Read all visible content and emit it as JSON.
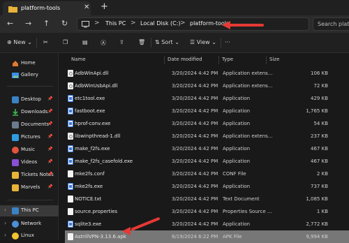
{
  "window": {
    "tab_title": "platform-tools",
    "close_glyph": "✕",
    "new_tab_glyph": "+"
  },
  "address": {
    "back_glyph": "←",
    "forward_glyph": "→",
    "up_glyph": "↑",
    "refresh_glyph": "↻",
    "chevron": ">",
    "crumbs": [
      "This PC",
      "Local Disk (C:)",
      "platform-tools"
    ],
    "search_placeholder": "Search platfo"
  },
  "toolbar": {
    "new_label": "New",
    "sort_label": "Sort",
    "view_label": "View",
    "more_label": "···"
  },
  "sidebar": {
    "top": [
      {
        "label": "Home",
        "icon": "home-icon"
      },
      {
        "label": "Gallery",
        "icon": "gallery-icon"
      }
    ],
    "pinned": [
      {
        "label": "Desktop",
        "icon": "desktop-icon"
      },
      {
        "label": "Downloads",
        "icon": "download-icon"
      },
      {
        "label": "Documents",
        "icon": "documents-icon"
      },
      {
        "label": "Pictures",
        "icon": "pictures-icon"
      },
      {
        "label": "Music",
        "icon": "music-icon"
      },
      {
        "label": "Videos",
        "icon": "videos-icon"
      },
      {
        "label": "Tickets Notes",
        "icon": "folder-icon"
      },
      {
        "label": "Marvels",
        "icon": "folder-icon"
      }
    ],
    "bottom": [
      {
        "label": "This PC",
        "icon": "pc-icon"
      },
      {
        "label": "Network",
        "icon": "network-icon"
      },
      {
        "label": "Linux",
        "icon": "linux-icon"
      }
    ],
    "pin_glyph": "📌",
    "chevron_glyph": "›"
  },
  "table": {
    "columns": [
      "Name",
      "Date modified",
      "Type",
      "Size"
    ],
    "rows": [
      {
        "name": "AdbWinApi.dll",
        "date": "3/20/2024 4:42 PM",
        "type": "Application extens...",
        "size": "106 KB",
        "kind": "dll"
      },
      {
        "name": "AdbWinUsbApi.dll",
        "date": "3/20/2024 4:42 PM",
        "type": "Application extens...",
        "size": "72 KB",
        "kind": "dll"
      },
      {
        "name": "etc1tool.exe",
        "date": "3/20/2024 4:42 PM",
        "type": "Application",
        "size": "429 KB",
        "kind": "exe"
      },
      {
        "name": "fastboot.exe",
        "date": "3/20/2024 4:42 PM",
        "type": "Application",
        "size": "1,765 KB",
        "kind": "exe"
      },
      {
        "name": "hprof-conv.exe",
        "date": "3/20/2024 4:42 PM",
        "type": "Application",
        "size": "54 KB",
        "kind": "exe"
      },
      {
        "name": "libwinpthread-1.dll",
        "date": "3/20/2024 4:42 PM",
        "type": "Application extens...",
        "size": "237 KB",
        "kind": "dll"
      },
      {
        "name": "make_f2fs.exe",
        "date": "3/20/2024 4:42 PM",
        "type": "Application",
        "size": "467 KB",
        "kind": "exe"
      },
      {
        "name": "make_f2fs_casefold.exe",
        "date": "3/20/2024 4:42 PM",
        "type": "Application",
        "size": "467 KB",
        "kind": "exe"
      },
      {
        "name": "mke2fs.conf",
        "date": "3/20/2024 4:42 PM",
        "type": "CONF File",
        "size": "2 KB",
        "kind": "file"
      },
      {
        "name": "mke2fs.exe",
        "date": "3/20/2024 4:42 PM",
        "type": "Application",
        "size": "737 KB",
        "kind": "exe"
      },
      {
        "name": "NOTICE.txt",
        "date": "3/20/2024 4:42 PM",
        "type": "Text Document",
        "size": "1,085 KB",
        "kind": "file"
      },
      {
        "name": "source.properties",
        "date": "3/20/2024 4:42 PM",
        "type": "Properties Source ...",
        "size": "1 KB",
        "kind": "file"
      },
      {
        "name": "sqlite3.exe",
        "date": "3/20/2024 4:42 PM",
        "type": "Application",
        "size": "2,772 KB",
        "kind": "exe"
      },
      {
        "name": "AstrillVPN-3.13.6.apk",
        "date": "6/19/2024 6:22 PM",
        "type": "APK File",
        "size": "9,994 KB",
        "kind": "file",
        "selected": true
      }
    ]
  },
  "colors": {
    "accent_red": "#e53935",
    "selected_row": "#777777",
    "background": "#191919"
  }
}
